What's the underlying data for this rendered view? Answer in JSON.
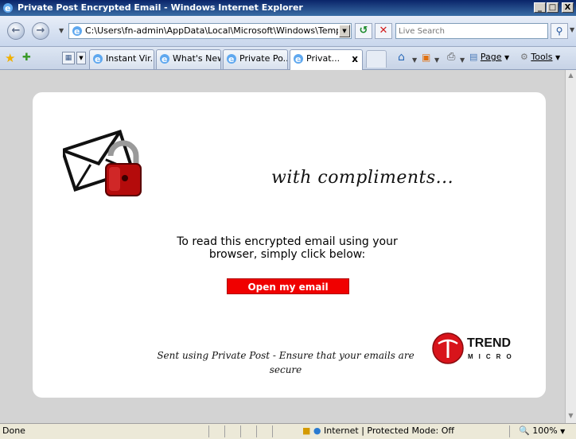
{
  "window": {
    "title": "Private Post Encrypted Email - Windows Internet Explorer",
    "min_label": "_",
    "max_label": "□",
    "close_label": "X"
  },
  "address_bar": {
    "url": "C:\\Users\\fn-admin\\AppData\\Local\\Microsoft\\Windows\\Temporary Inte",
    "search_placeholder": "Live Search"
  },
  "tabs": [
    {
      "label": "Instant Vir..."
    },
    {
      "label": "What's New"
    },
    {
      "label": "Private Po..."
    },
    {
      "label": "Privat...",
      "active": true
    }
  ],
  "tab_close_label": "x",
  "commands": {
    "page_label": "Page",
    "tools_label": "Tools"
  },
  "content": {
    "headline": "with compliments...",
    "instructions": "To read this encrypted email using your browser, simply click below:",
    "open_button": "Open my email",
    "footer": "Sent using Private Post - Ensure that your emails are secure",
    "logo_text_1": "TREND",
    "logo_text_2": "MICRO"
  },
  "status_bar": {
    "status": "Done",
    "zone": "Internet | Protected Mode: Off",
    "zoom": "100%"
  },
  "colors": {
    "accent_red": "#f00000",
    "titlebar": "#0a246a",
    "page_bg": "#d3d3d3"
  },
  "icons": [
    "ie-icon",
    "back-icon",
    "forward-icon",
    "refresh-icon",
    "stop-icon",
    "search-icon",
    "favorites-star-icon",
    "add-favorites-icon",
    "quick-tabs-icon",
    "home-icon",
    "feeds-icon",
    "print-icon",
    "page-icon",
    "tools-icon",
    "padlock-envelope-icon",
    "trend-micro-logo",
    "protected-mode-icon",
    "globe-icon",
    "zoom-icon"
  ]
}
